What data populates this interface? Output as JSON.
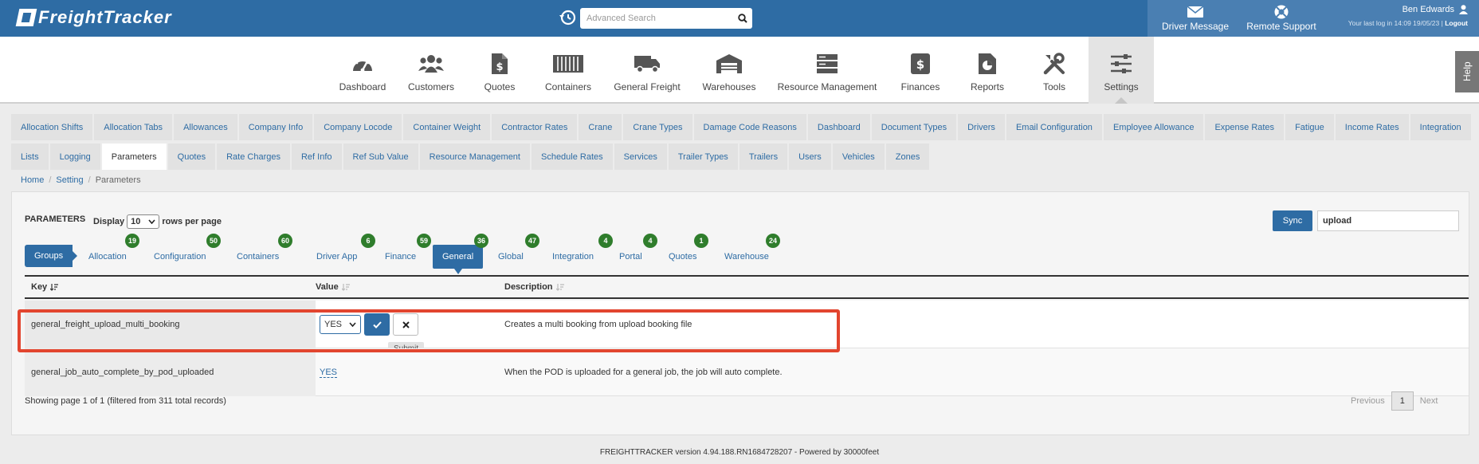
{
  "header": {
    "logo_text": "FreightTracker",
    "search_placeholder": "Advanced Search",
    "driver_message": "Driver Message",
    "remote_support": "Remote Support",
    "user_name": "Ben Edwards",
    "last_login": "Your last log in 14:09 19/05/23 |",
    "logout": "Logout"
  },
  "nav": {
    "items": [
      {
        "label": "Dashboard",
        "icon": "speedometer-icon"
      },
      {
        "label": "Customers",
        "icon": "users-icon"
      },
      {
        "label": "Quotes",
        "icon": "document-dollar-icon"
      },
      {
        "label": "Containers",
        "icon": "container-icon"
      },
      {
        "label": "General Freight",
        "icon": "truck-icon"
      },
      {
        "label": "Warehouses",
        "icon": "warehouse-icon"
      },
      {
        "label": "Resource Management",
        "icon": "server-icon"
      },
      {
        "label": "Finances",
        "icon": "dollar-file-icon"
      },
      {
        "label": "Reports",
        "icon": "report-chart-icon"
      },
      {
        "label": "Tools",
        "icon": "tools-icon"
      },
      {
        "label": "Settings",
        "icon": "sliders-icon"
      }
    ],
    "help": "Help"
  },
  "subtabs_row1": [
    "Allocation Shifts",
    "Allocation Tabs",
    "Allowances",
    "Company Info",
    "Company Locode",
    "Container Weight",
    "Contractor Rates",
    "Crane",
    "Crane Types",
    "Damage Code Reasons",
    "Dashboard",
    "Document Types",
    "Drivers",
    "Email Configuration",
    "Employee Allowance",
    "Expense Rates",
    "Fatigue",
    "Income Rates",
    "Integration"
  ],
  "subtabs_row2": [
    "Lists",
    "Logging",
    "Parameters",
    "Quotes",
    "Rate Charges",
    "Ref Info",
    "Ref Sub Value",
    "Resource Management",
    "Schedule Rates",
    "Services",
    "Trailer Types",
    "Trailers",
    "Users",
    "Vehicles",
    "Zones"
  ],
  "breadcrumb": {
    "home": "Home",
    "setting": "Setting",
    "current": "Parameters"
  },
  "panel": {
    "title": "PARAMETERS",
    "display_label": "Display",
    "rows_value": "10",
    "rows_label": "rows per page",
    "sync": "Sync",
    "filter_value": "upload"
  },
  "groups": {
    "button": "Groups",
    "tabs": [
      {
        "label": "Allocation",
        "count": "19"
      },
      {
        "label": "Configuration",
        "count": "50"
      },
      {
        "label": "Containers",
        "count": "60"
      },
      {
        "label": "Driver App",
        "count": "6"
      },
      {
        "label": "Finance",
        "count": "59"
      },
      {
        "label": "General",
        "count": "36"
      },
      {
        "label": "Global",
        "count": "47"
      },
      {
        "label": "Integration",
        "count": "4"
      },
      {
        "label": "Portal",
        "count": "4"
      },
      {
        "label": "Quotes",
        "count": "1"
      },
      {
        "label": "Warehouse",
        "count": "24"
      }
    ]
  },
  "table": {
    "headers": {
      "key": "Key",
      "value": "Value",
      "description": "Description"
    },
    "rows": [
      {
        "key": "general_freight_upload_multi_booking",
        "value": "YES",
        "description": "Creates a multi booking from upload booking file"
      },
      {
        "key": "general_job_auto_complete_by_pod_uploaded",
        "value": "YES",
        "description": "When the POD is uploaded for a general job, the job will auto complete."
      }
    ],
    "tooltip": "Submit"
  },
  "pagination": {
    "showing": "Showing page 1 of 1 (filtered from 311 total records)",
    "previous": "Previous",
    "page": "1",
    "next": "Next"
  },
  "footer": "FREIGHTTRACKER version 4.94.188.RN1684728207 - Powered by 30000feet",
  "colors": {
    "brand": "#2e6ca4",
    "badge": "#2f7d2c",
    "highlight": "#e2452f"
  }
}
